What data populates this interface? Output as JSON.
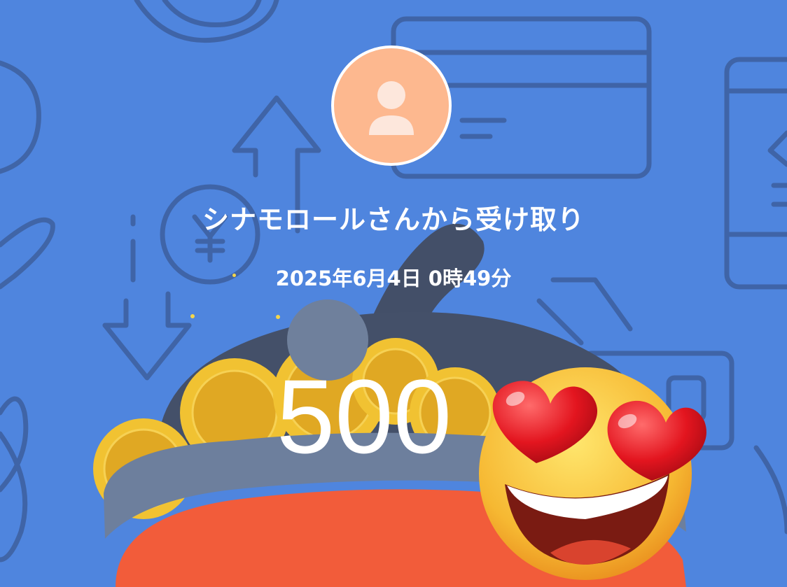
{
  "sender": {
    "avatar_icon": "person-icon",
    "message": "シナモロールさんから受け取り"
  },
  "transaction": {
    "datetime": "2025年6月4日 0時49分",
    "amount": "500"
  },
  "decoration": {
    "background_color": "#4f85de",
    "pattern_color": "#3d5f9e",
    "wallet_icon": "coin-purse-icon",
    "emoji_icon": "heart-eyes-emoji-icon"
  }
}
